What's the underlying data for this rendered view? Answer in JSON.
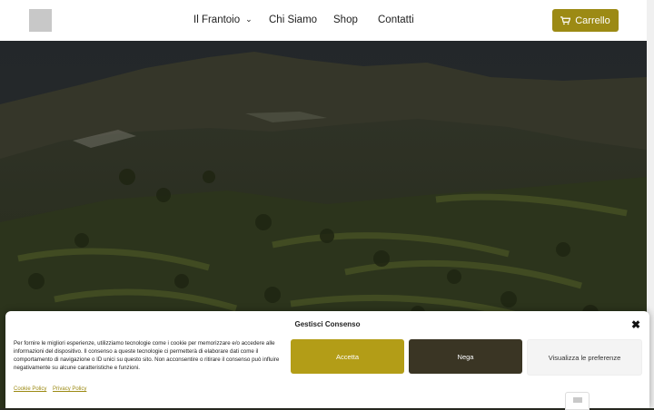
{
  "header": {
    "nav": [
      {
        "label": "Il Frantoio",
        "has_dropdown": true
      },
      {
        "label": "Chi Siamo"
      },
      {
        "label": "Shop"
      },
      {
        "label": "Contatti"
      }
    ],
    "cart_label": "Carrello"
  },
  "consent": {
    "title": "Gestisci Consenso",
    "text": "Per fornire le migliori esperienze, utilizziamo tecnologie come i cookie per memorizzare e/o accedere alle informazioni del dispositivo. Il consenso a queste tecnologie ci permetterà di elaborare dati come il comportamento di navigazione o ID unici su questo sito. Non acconsentire o ritirare il consenso può influire negativamente su alcune caratteristiche e funzioni.",
    "accept_label": "Accetta",
    "deny_label": "Nega",
    "prefs_label": "Visualizza le preferenze",
    "links": [
      "Cookie Policy",
      "Privacy Policy"
    ]
  },
  "colors": {
    "accent": "#b39d17",
    "deny": "#3a3524"
  },
  "icons": [
    "cart-icon",
    "close-icon",
    "chevron-down-icon"
  ]
}
